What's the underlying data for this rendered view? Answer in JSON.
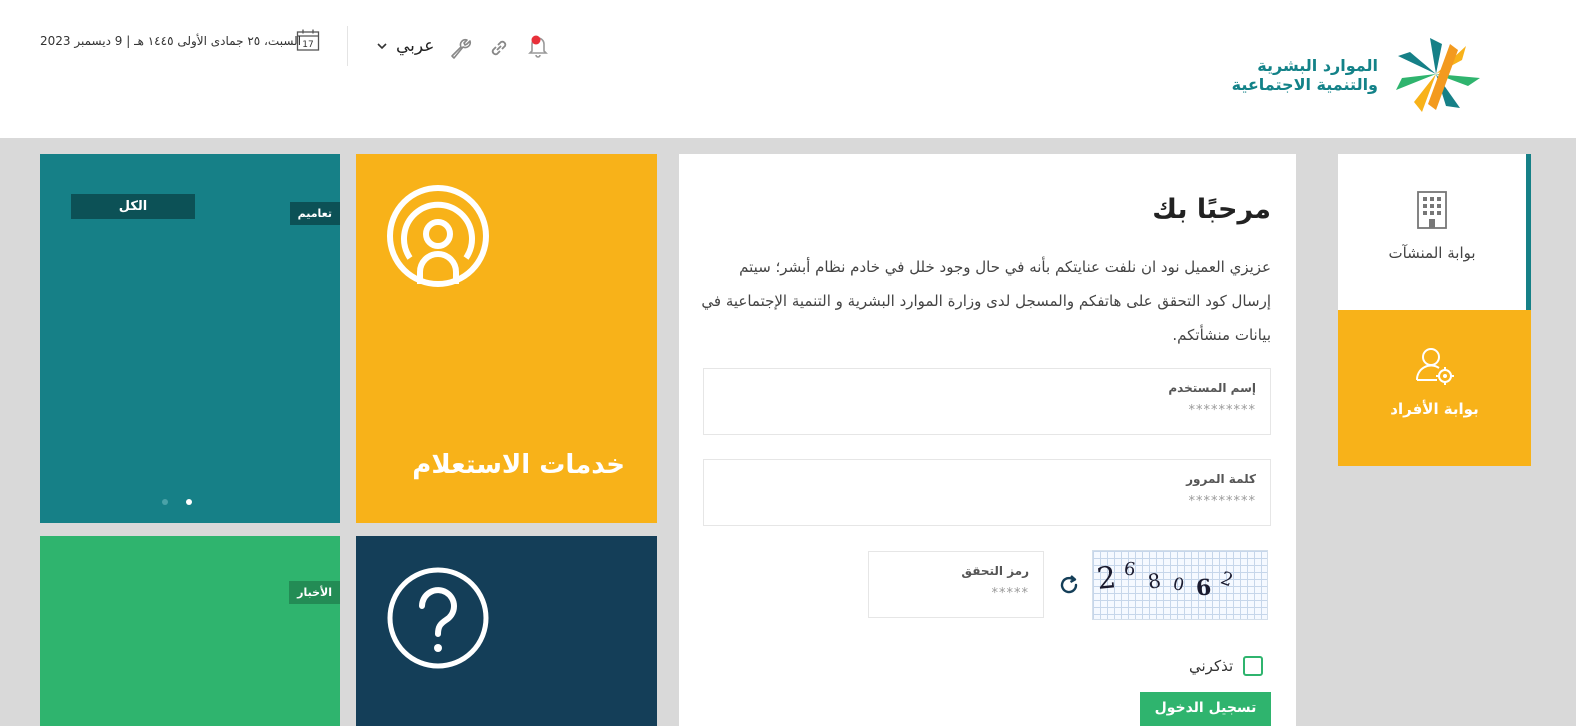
{
  "header": {
    "logo_line1": "الموارد البشرية",
    "logo_line2": "والتنمية الاجتماعية",
    "language": "عربي",
    "date": "السبت، ٢٥ جمادى الأولى ١٤٤٥ هـ | 9 ديسمبر 2023",
    "calendar_day": "17"
  },
  "tiles": {
    "all_label": "الكل",
    "circulars_label": "تعاميم",
    "inquiry_title": "خدمات الاستعلام",
    "news_label": "الأخبار"
  },
  "login": {
    "welcome": "مرحبًا بك",
    "notice": "عزيزي العميل نود ان نلفت عنايتكم بأنه في حال وجود خلل في خادم نظام أبشر؛ سيتم إرسال كود التحقق على هاتفكم والمسجل لدى وزارة الموارد البشرية و التنمية الإجتماعية في بيانات منشأتكم.",
    "username_label": "إسم المستخدم",
    "username_placeholder": "*********",
    "password_label": "كلمة المرور",
    "password_placeholder": "*********",
    "captcha_label": "رمز التحقق",
    "captcha_placeholder": "*****",
    "captcha_chars": [
      "2",
      "6",
      "8",
      "0",
      "6",
      "2"
    ],
    "remember_label": "تذكرني",
    "login_button": "تسجيل الدخول"
  },
  "portals": {
    "establishments": "بوابة المنشآت",
    "individuals": "بوابة الأفراد"
  },
  "colors": {
    "teal": "#168087",
    "yellow": "#f8b219",
    "green": "#2fb46e",
    "navy": "#143e58"
  }
}
